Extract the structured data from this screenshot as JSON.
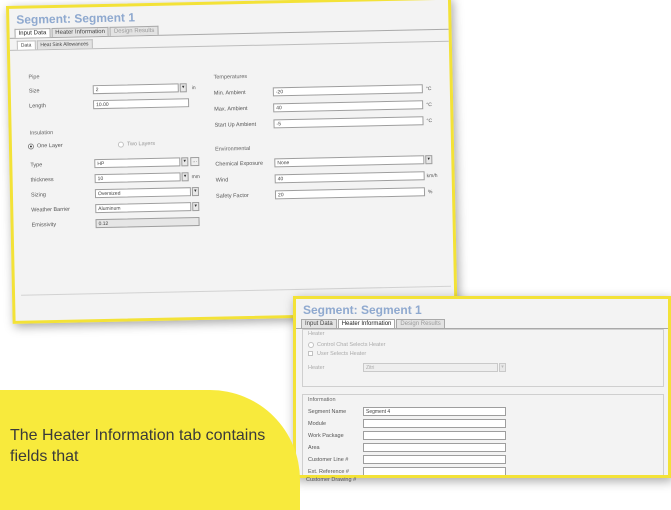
{
  "callout": {
    "text": "The Heater Information tab contains fields that"
  },
  "window1": {
    "title": "Segment: Segment 1",
    "tabs": [
      "Input Data",
      "Heater Information",
      "Design Results"
    ],
    "subtabs": [
      "Data",
      "Heat Sink Allowances"
    ],
    "pipe": {
      "group_label": "Pipe",
      "size_label": "Size",
      "size_value": "2",
      "size_unit": "in",
      "length_label": "Length",
      "length_value": "10.00"
    },
    "insulation": {
      "group_label": "Insulation",
      "one_layer_label": "One Layer",
      "two_layers_label": "Two Layers",
      "type_label": "Type",
      "type_value": "HP",
      "thickness_label": "thickness",
      "thickness_value": "10",
      "thickness_unit": "mm",
      "sizing_label": "Sizing",
      "sizing_value": "Oversized",
      "weather_barrier_label": "Weather Barrier",
      "weather_barrier_value": "Aluminum",
      "emissivity_label": "Emissivity",
      "emissivity_value": "0.12"
    },
    "temperatures": {
      "group_label": "Temperatures",
      "min_ambient_label": "Min. Ambient",
      "min_ambient_value": "-20",
      "max_ambient_label": "Max. Ambient",
      "max_ambient_value": "40",
      "startup_ambient_label": "Start Up Ambient",
      "startup_ambient_value": "-5",
      "unit": "°C"
    },
    "environmental": {
      "group_label": "Environmental",
      "chemical_exposure_label": "Chemical Exposure",
      "chemical_exposure_value": "None",
      "wind_label": "Wind",
      "wind_value": "40",
      "wind_unit": "km/h",
      "safety_factor_label": "Safety Factor",
      "safety_factor_value": "20",
      "safety_factor_unit": "%"
    }
  },
  "window2": {
    "title": "Segment: Segment 1",
    "tabs": [
      "Input Data",
      "Heater Information",
      "Design Results"
    ],
    "heater": {
      "group_label": "Heater",
      "option_control": "Control Chat Selects Heater",
      "option_user": "User Selects Heater",
      "heater_label": "Heater",
      "heater_value": "Zitri"
    },
    "information": {
      "group_label": "Information",
      "segment_name_label": "Segment Name",
      "segment_name_value": "Segment 4",
      "module_label": "Module",
      "work_package_label": "Work Package",
      "area_label": "Area",
      "customer_line_label": "Customer Line #",
      "ext_reference_label": "Ext. Reference #",
      "customer_drawing_label": "Customer Drawing #"
    }
  }
}
